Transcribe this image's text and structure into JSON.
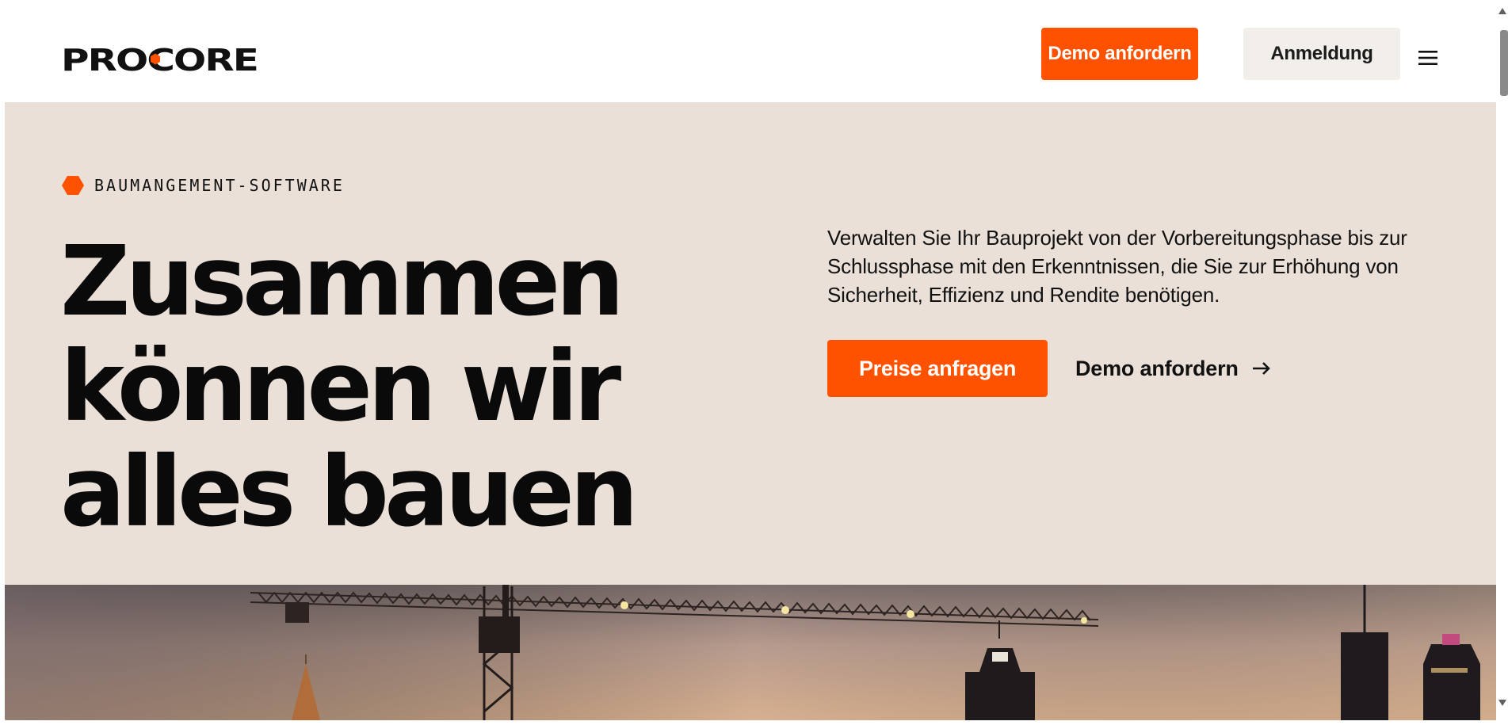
{
  "header": {
    "logo_text": "PROCORE",
    "demo_button": "Demo anfordern",
    "login_button": "Anmeldung",
    "menu_icon": "hamburger-menu-icon"
  },
  "hero": {
    "eyebrow": "BAUMANGEMENT-SOFTWARE",
    "headline_lines": [
      "Zusammen",
      "können wir",
      "alles bauen"
    ],
    "intro": "Verwalten Sie Ihr Bauprojekt von der Vorbereitungsphase bis zur Schlussphase mit den Erkenntnissen, die Sie zur Erhöhung von Sicherheit, Effizienz und Rendite benötigen.",
    "pricing_button": "Preise anfragen",
    "demo_link": "Demo anfordern",
    "demo_link_icon": "arrow-right-icon"
  },
  "colors": {
    "brand_orange": "#ff5200",
    "hero_background": "#eae0d7",
    "login_background": "#f2efea"
  }
}
